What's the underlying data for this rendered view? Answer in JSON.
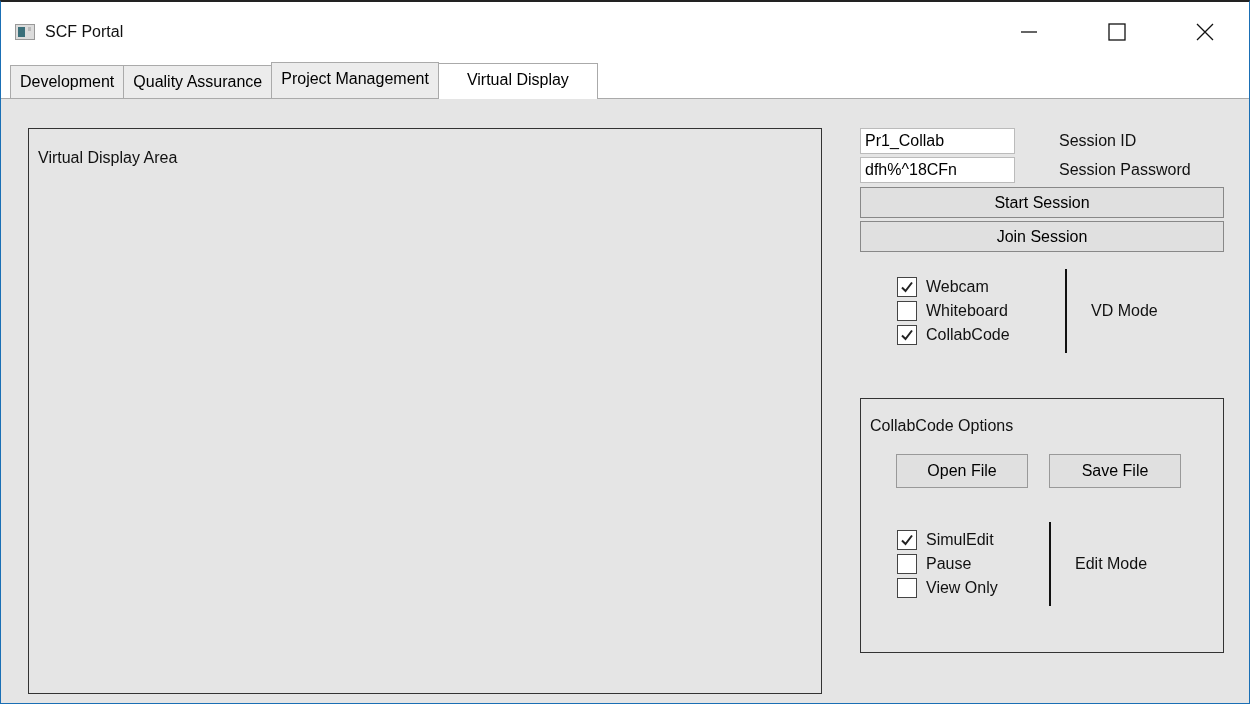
{
  "window": {
    "title": "SCF Portal"
  },
  "tabs": [
    {
      "label": "Development",
      "selected": false
    },
    {
      "label": "Quality Assurance",
      "selected": false
    },
    {
      "label": "Project Management",
      "selected": false
    },
    {
      "label": "Virtual Display",
      "selected": true
    }
  ],
  "display_area": {
    "label": "Virtual Display Area"
  },
  "session": {
    "fields": [
      {
        "value": "Pr1_Collab",
        "label": "Session ID"
      },
      {
        "value": "dfh%^18CFn",
        "label": "Session Password"
      }
    ],
    "buttons": [
      "Start Session",
      "Join Session"
    ]
  },
  "vd_mode": {
    "label": "VD Mode",
    "options": [
      {
        "label": "Webcam",
        "checked": true
      },
      {
        "label": "Whiteboard",
        "checked": false
      },
      {
        "label": "CollabCode",
        "checked": true
      }
    ]
  },
  "collabcode_options": {
    "title": "CollabCode Options",
    "buttons": [
      "Open File",
      "Save File"
    ],
    "edit_mode": {
      "label": "Edit Mode",
      "options": [
        {
          "label": "SimulEdit",
          "checked": true
        },
        {
          "label": "Pause",
          "checked": false
        },
        {
          "label": "View Only",
          "checked": false
        }
      ]
    }
  }
}
